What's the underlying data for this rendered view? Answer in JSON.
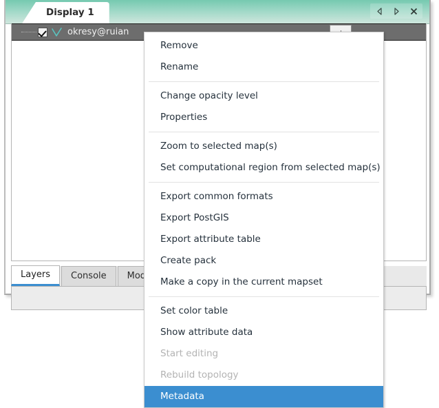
{
  "window": {
    "display_tab_label": "Display 1",
    "controls": [
      {
        "name": "previous-icon",
        "glyph": "left-triangle"
      },
      {
        "name": "next-icon",
        "glyph": "right-triangle"
      },
      {
        "name": "close-icon",
        "glyph": "x"
      }
    ]
  },
  "layer_tree": {
    "row": {
      "label": "okresy@ruian",
      "checked": true,
      "icon": "vector-layer-icon",
      "selected": true
    }
  },
  "bottom_tabs": [
    {
      "label": "Layers",
      "active": true
    },
    {
      "label": "Console",
      "active": false
    },
    {
      "label": "Modules",
      "active": false
    }
  ],
  "context_menu": {
    "groups": [
      {
        "items": [
          {
            "label": "Remove",
            "state": "enabled"
          },
          {
            "label": "Rename",
            "state": "enabled"
          }
        ]
      },
      {
        "items": [
          {
            "label": "Change opacity level",
            "state": "enabled"
          },
          {
            "label": "Properties",
            "state": "enabled"
          }
        ]
      },
      {
        "items": [
          {
            "label": "Zoom to selected map(s)",
            "state": "enabled"
          },
          {
            "label": "Set computational region from selected map(s)",
            "state": "enabled"
          }
        ]
      },
      {
        "items": [
          {
            "label": "Export common formats",
            "state": "enabled"
          },
          {
            "label": "Export PostGIS",
            "state": "enabled"
          },
          {
            "label": "Export attribute table",
            "state": "enabled"
          },
          {
            "label": "Create pack",
            "state": "enabled"
          },
          {
            "label": "Make a copy in the current mapset",
            "state": "enabled"
          }
        ]
      },
      {
        "items": [
          {
            "label": "Set color table",
            "state": "enabled"
          },
          {
            "label": "Show attribute data",
            "state": "enabled"
          },
          {
            "label": "Start editing",
            "state": "disabled"
          },
          {
            "label": "Rebuild topology",
            "state": "disabled"
          },
          {
            "label": "Metadata",
            "state": "selected"
          }
        ]
      }
    ]
  },
  "colors": {
    "header_gradient_top": "#76c9b0",
    "header_gradient_bottom": "#cfe6dd",
    "selection_blue": "#3b8ed0",
    "row_selected_grey": "#6d6d6d",
    "vector_icon": "#59c5c0",
    "menu_text": "#25313c",
    "menu_disabled_text": "#b3b3b3"
  }
}
